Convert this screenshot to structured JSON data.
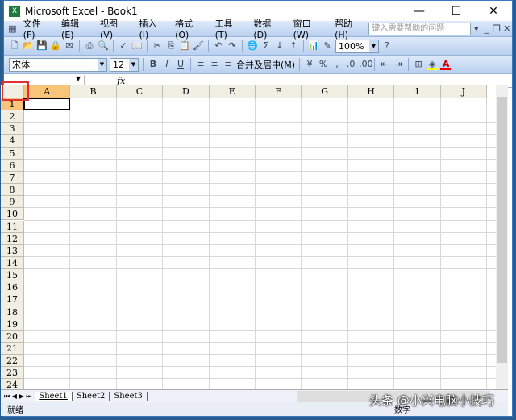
{
  "window": {
    "title": "Microsoft Excel - Book1",
    "minimize": "—",
    "maximize": "☐",
    "close": "✕"
  },
  "menu": {
    "items": [
      "文件(F)",
      "编辑(E)",
      "视图(V)",
      "插入(I)",
      "格式(O)",
      "工具(T)",
      "数据(D)",
      "窗口(W)",
      "帮助(H)"
    ],
    "help_placeholder": "键入需要帮助的问题"
  },
  "toolbar": {
    "zoom": "100%"
  },
  "format": {
    "font": "宋体",
    "size": "12",
    "bold": "B",
    "italic": "I",
    "underline": "U",
    "merge": "合并及居中(M)",
    "percent": "%",
    "comma": ",",
    "font_color": "A"
  },
  "formula": {
    "fx": "fx",
    "name": ""
  },
  "columns": [
    "A",
    "B",
    "C",
    "D",
    "E",
    "F",
    "G",
    "H",
    "I",
    "J"
  ],
  "rows": [
    "1",
    "2",
    "3",
    "4",
    "5",
    "6",
    "7",
    "8",
    "9",
    "10",
    "11",
    "12",
    "13",
    "14",
    "15",
    "16",
    "17",
    "18",
    "19",
    "20",
    "21",
    "22",
    "23",
    "24"
  ],
  "sheets": [
    "Sheet1",
    "Sheet2",
    "Sheet3"
  ],
  "status": {
    "ready": "就绪",
    "mode": "数字"
  },
  "watermark": "头条 @小兴电脑小技巧"
}
